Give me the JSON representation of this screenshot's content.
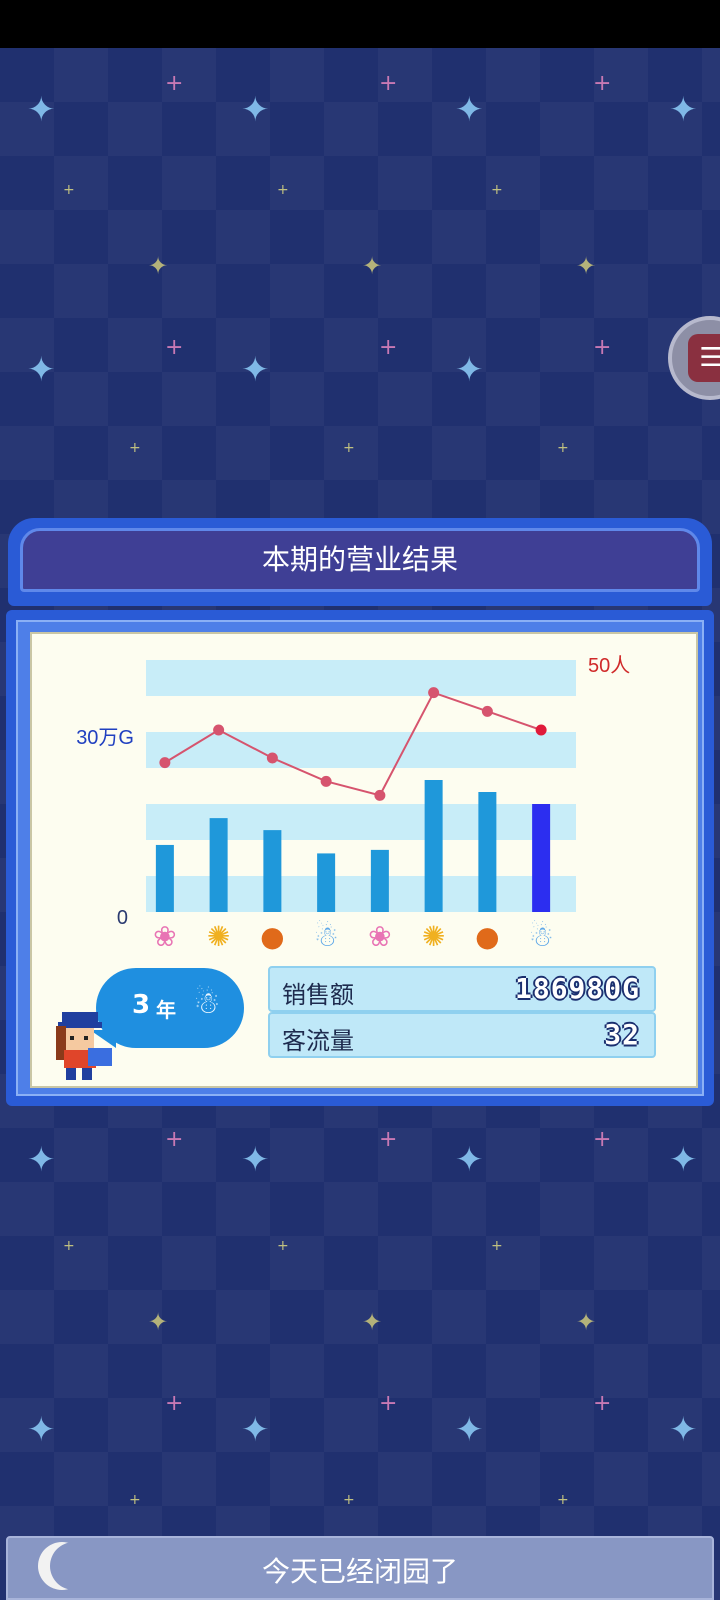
{
  "panel": {
    "title": "本期的营业结果"
  },
  "chart_data": {
    "type": "bar",
    "categories": [
      "spring-icon",
      "summer-icon",
      "autumn-icon",
      "winter-icon",
      "spring-icon",
      "summer-icon",
      "autumn-icon",
      "winter-icon"
    ],
    "y_left_label_top": "30万G",
    "y_left_label_zero": "0",
    "y_right_label_top": "50人",
    "series": [
      {
        "values": [
          95000,
          133000,
          116000,
          83000,
          88000,
          187000,
          170000,
          153000
        ],
        "kind": "bar"
      },
      {
        "values": [
          32,
          39,
          33,
          28,
          25,
          47,
          43,
          39
        ],
        "kind": "line"
      }
    ],
    "current_index": 7,
    "colors": {
      "bar": "#1f98da",
      "bar_current": "#2c2ef0",
      "line": "#d6546e",
      "band": "#c8edf8",
      "left_axis": "#2040c0",
      "right_axis": "#d02a2a"
    }
  },
  "year_badge": {
    "number": "3",
    "label": "年",
    "season_icon": "winter-icon"
  },
  "stats": {
    "sales_label": "销售额",
    "sales_value": "186980G",
    "customers_label": "客流量",
    "customers_value": "32"
  },
  "bottom": {
    "closed_text": "今天已经闭园了"
  }
}
